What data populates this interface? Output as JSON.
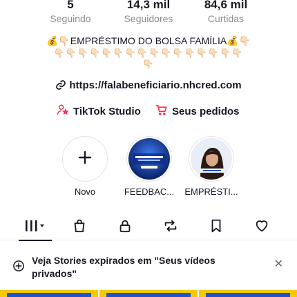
{
  "stats": [
    {
      "value": "5",
      "label": "Seguindo"
    },
    {
      "value": "14,3 mil",
      "label": "Seguidores"
    },
    {
      "value": "84,6 mil",
      "label": "Curtidas"
    }
  ],
  "bio": {
    "line1": "💰👇🏻EMPRÉSTIMO DO BOLSA FAMÍLIA💰👇🏻",
    "line2": "👇🏻👇🏻👇🏻👇🏻👇🏻👇🏻👇🏻👇🏻👇🏻👇🏻👇🏻👇🏻👇🏻👇🏻👇🏻👇🏻",
    "line3": "👇🏻"
  },
  "link": {
    "url": "https://falabeneficiario.nhcred.com",
    "icon": "link-icon"
  },
  "quick_links": [
    {
      "label": "TikTok Studio",
      "icon": "tiktok-studio-icon",
      "color": "#fe2c55"
    },
    {
      "label": "Seus pedidos",
      "icon": "cart-icon",
      "color": "#fe2c55"
    }
  ],
  "highlights": [
    {
      "label": "Novo",
      "icon": "plus-icon"
    },
    {
      "label": "FEEDBAC...",
      "image": "blue-ad-thumbnail"
    },
    {
      "label": "EMPRÉSTI...",
      "image": "woman-portrait-thumbnail"
    }
  ],
  "tabs": [
    {
      "name": "videos",
      "icon": "grid-icon",
      "active": true
    },
    {
      "name": "shop",
      "icon": "bag-icon"
    },
    {
      "name": "private",
      "icon": "lock-icon"
    },
    {
      "name": "reposts",
      "icon": "repost-icon"
    },
    {
      "name": "favorites",
      "icon": "bookmark-icon"
    },
    {
      "name": "liked",
      "icon": "heart-icon"
    }
  ],
  "banner": {
    "text": "Veja Stories expirados em \"Seus vídeos privados\"",
    "icon": "story-add-icon",
    "close_icon": "close-icon"
  },
  "colors": {
    "accent": "#fe2c55",
    "video_bg": "#f5c800"
  }
}
